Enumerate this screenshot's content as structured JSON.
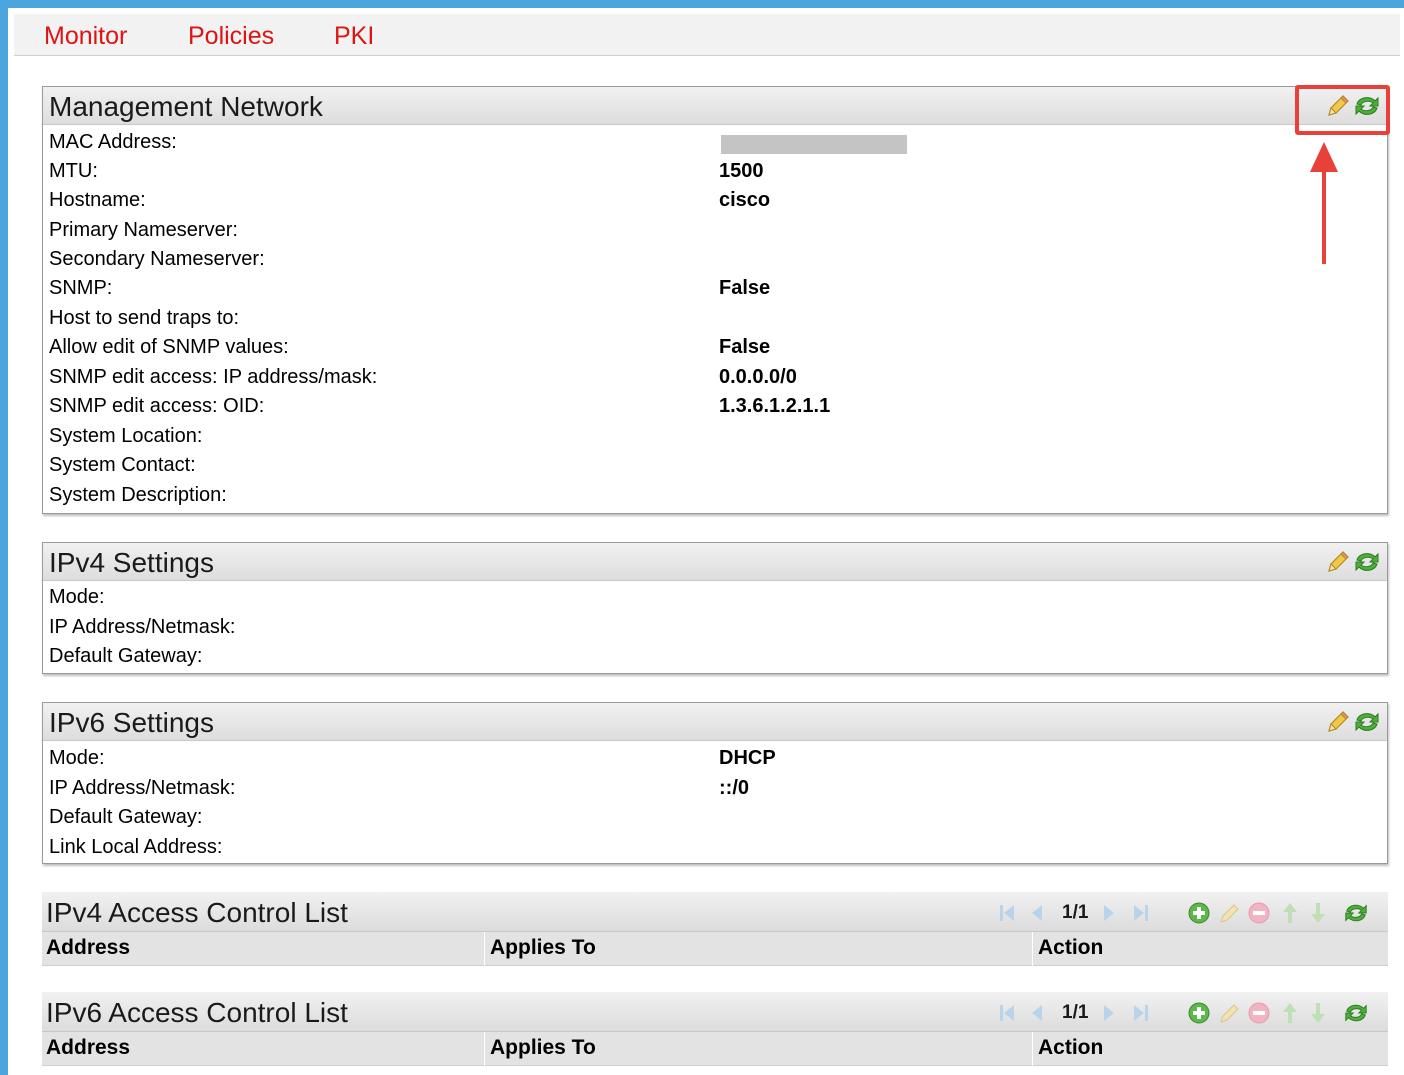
{
  "nav": {
    "items": [
      "Monitor",
      "Policies",
      "PKI"
    ]
  },
  "management_network": {
    "title": "Management Network",
    "rows": [
      {
        "label": "MAC Address:",
        "value": ""
      },
      {
        "label": "MTU:",
        "value": "1500"
      },
      {
        "label": "Hostname:",
        "value": "cisco"
      },
      {
        "label": "Primary Nameserver:",
        "value": ""
      },
      {
        "label": "Secondary Nameserver:",
        "value": ""
      },
      {
        "label": "SNMP:",
        "value": "False"
      },
      {
        "label": "Host to send traps to:",
        "value": ""
      },
      {
        "label": "Allow edit of SNMP values:",
        "value": "False"
      },
      {
        "label": "SNMP edit access: IP address/mask:",
        "value": "0.0.0.0/0"
      },
      {
        "label": "SNMP edit access: OID:",
        "value": "1.3.6.1.2.1.1"
      },
      {
        "label": "System Location:",
        "value": ""
      },
      {
        "label": "System Contact:",
        "value": ""
      },
      {
        "label": "System Description:",
        "value": ""
      }
    ]
  },
  "ipv4_settings": {
    "title": "IPv4 Settings",
    "rows": [
      {
        "label": "Mode:",
        "value": ""
      },
      {
        "label": "IP Address/Netmask:",
        "value": ""
      },
      {
        "label": "Default Gateway:",
        "value": ""
      }
    ]
  },
  "ipv6_settings": {
    "title": "IPv6 Settings",
    "rows": [
      {
        "label": "Mode:",
        "value": "DHCP"
      },
      {
        "label": "IP Address/Netmask:",
        "value": "::/0"
      },
      {
        "label": "Default Gateway:",
        "value": ""
      },
      {
        "label": "Link Local Address:",
        "value": ""
      }
    ]
  },
  "ipv4_acl": {
    "title": "IPv4 Access Control List",
    "page": "1/1",
    "columns": [
      "Address",
      "Applies To",
      "Action"
    ]
  },
  "ipv6_acl": {
    "title": "IPv6 Access Control List",
    "page": "1/1",
    "columns": [
      "Address",
      "Applies To",
      "Action"
    ]
  },
  "colors": {
    "frame": "#4aa6dd",
    "nav_text": "#dd1414",
    "highlight": "#e8413a",
    "edit_icon": "#e0b230",
    "refresh_icon": "#3f9b2b"
  },
  "icons": [
    "edit-pencil-icon",
    "refresh-icon",
    "first-page-icon",
    "prev-page-icon",
    "next-page-icon",
    "last-page-icon",
    "add-icon",
    "remove-icon",
    "move-up-icon",
    "move-down-icon"
  ]
}
